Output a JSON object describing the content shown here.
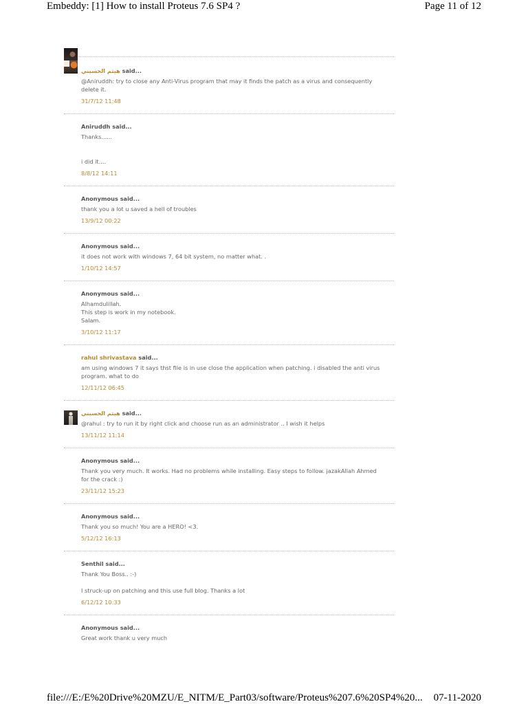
{
  "document": {
    "header_title": "Embeddy: [1] How to install Proteus 7.6 SP4 ?",
    "page_indicator": "Page 11 of 12",
    "footer_url": "file:///E:/E%20Drive%20MZU/E_NITM/E_Part03/software/Proteus%207.6%20SP4%20...",
    "footer_date": "07-11-2020"
  },
  "theme": {
    "link_color": "#b8892f",
    "author_color": "#555555",
    "text_color": "#666666",
    "divider_color": "#bbbbbb",
    "header_color": "#000000"
  },
  "labels": {
    "said": "said..."
  },
  "comments": [
    {
      "author": "هيثم الحسيني",
      "body": "@Aniruddh: try to close any Anti-Virus program that may it finds the patch as a virus and consequently delete it.",
      "timestamp": "31/7/12 11:48"
    },
    {
      "author": "Aniruddh",
      "body": "Thanks......\n\n\ni did it....",
      "timestamp": "8/8/12 14:11"
    },
    {
      "author": "Anonymous",
      "body": "thank you a lot u saved a hell of troubles",
      "timestamp": "13/9/12 00:22"
    },
    {
      "author": "Anonymous",
      "body": "it does not work with windows 7, 64 bit system, no matter what. .",
      "timestamp": "1/10/12 14:57"
    },
    {
      "author": "Anonymous",
      "body": "Alhamdulillah.\nThis step is work in my notebook.\nSalam.",
      "timestamp": "3/10/12 11:17"
    },
    {
      "author": "rahul shrivastava",
      "body": "am using windows 7 it says thst file is in use close the application when patching. i disabled the anti virus program. what to do",
      "timestamp": "12/11/12 06:45"
    },
    {
      "author": "هيثم الحسيني",
      "body": "@rahul : try to run it by right click and choose run as an administrator .. I wish it helps",
      "timestamp": "13/11/12 11:14"
    },
    {
      "author": "Anonymous",
      "body": "Thank you very much. It works. Had no problems while installing. Easy steps to follow. jazakAllah Ahmed for the crack :)",
      "timestamp": "23/11/12 15:23"
    },
    {
      "author": "Anonymous",
      "body": "Thank you so much! You are a HERO! <3.",
      "timestamp": "5/12/12 16:13"
    },
    {
      "author": "Senthil",
      "body": "Thank You Boss.. :-)\n\nI struck-up on patching and this use full blog. Thanks a lot",
      "timestamp": "6/12/12 10:33"
    },
    {
      "author": "Anonymous",
      "body": "Great work thank u very much"
    }
  ]
}
